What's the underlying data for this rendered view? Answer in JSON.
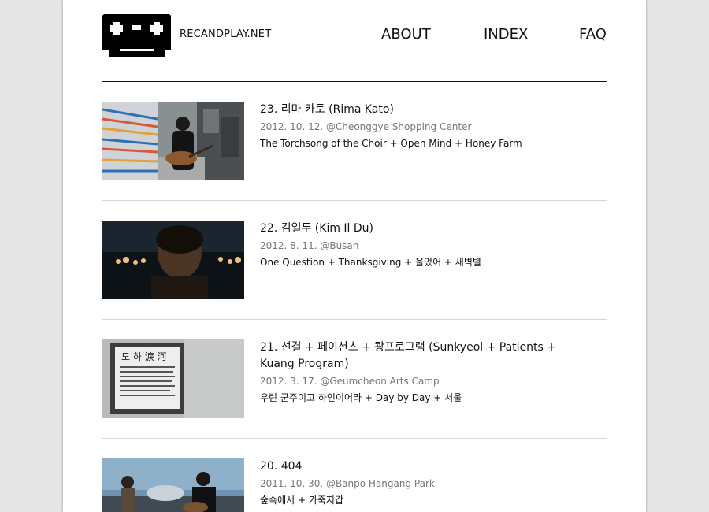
{
  "site": {
    "name": "RECANDPLAY.NET"
  },
  "nav": {
    "about": "ABOUT",
    "index": "INDEX",
    "faq": "FAQ"
  },
  "entries": [
    {
      "title": "23. 리마 카토 (Rima Kato)",
      "meta": "2012. 10. 12. @Cheonggye Shopping Center",
      "songs": "The Torchsong of the Choir + Open Mind + Honey Farm"
    },
    {
      "title": "22. 김일두 (Kim Il Du)",
      "meta": "2012. 8. 11. @Busan",
      "songs": "One Question + Thanksgiving + 울었어 + 새벽별"
    },
    {
      "title": "21. 선결 + 페이션츠 + 쾅프로그램 (Sunkyeol + Patients + Kuang Program)",
      "meta": "2012. 3. 17. @Geumcheon Arts Camp",
      "songs": "우린 군주이고 하인이어라 + Day by Day + 서울"
    },
    {
      "title": "20. 404",
      "meta": "2011. 10. 30. @Banpo Hangang Park",
      "songs": "숲속에서 + 가죽지갑"
    }
  ],
  "thumb_sign_text": "도 하 淚 河"
}
